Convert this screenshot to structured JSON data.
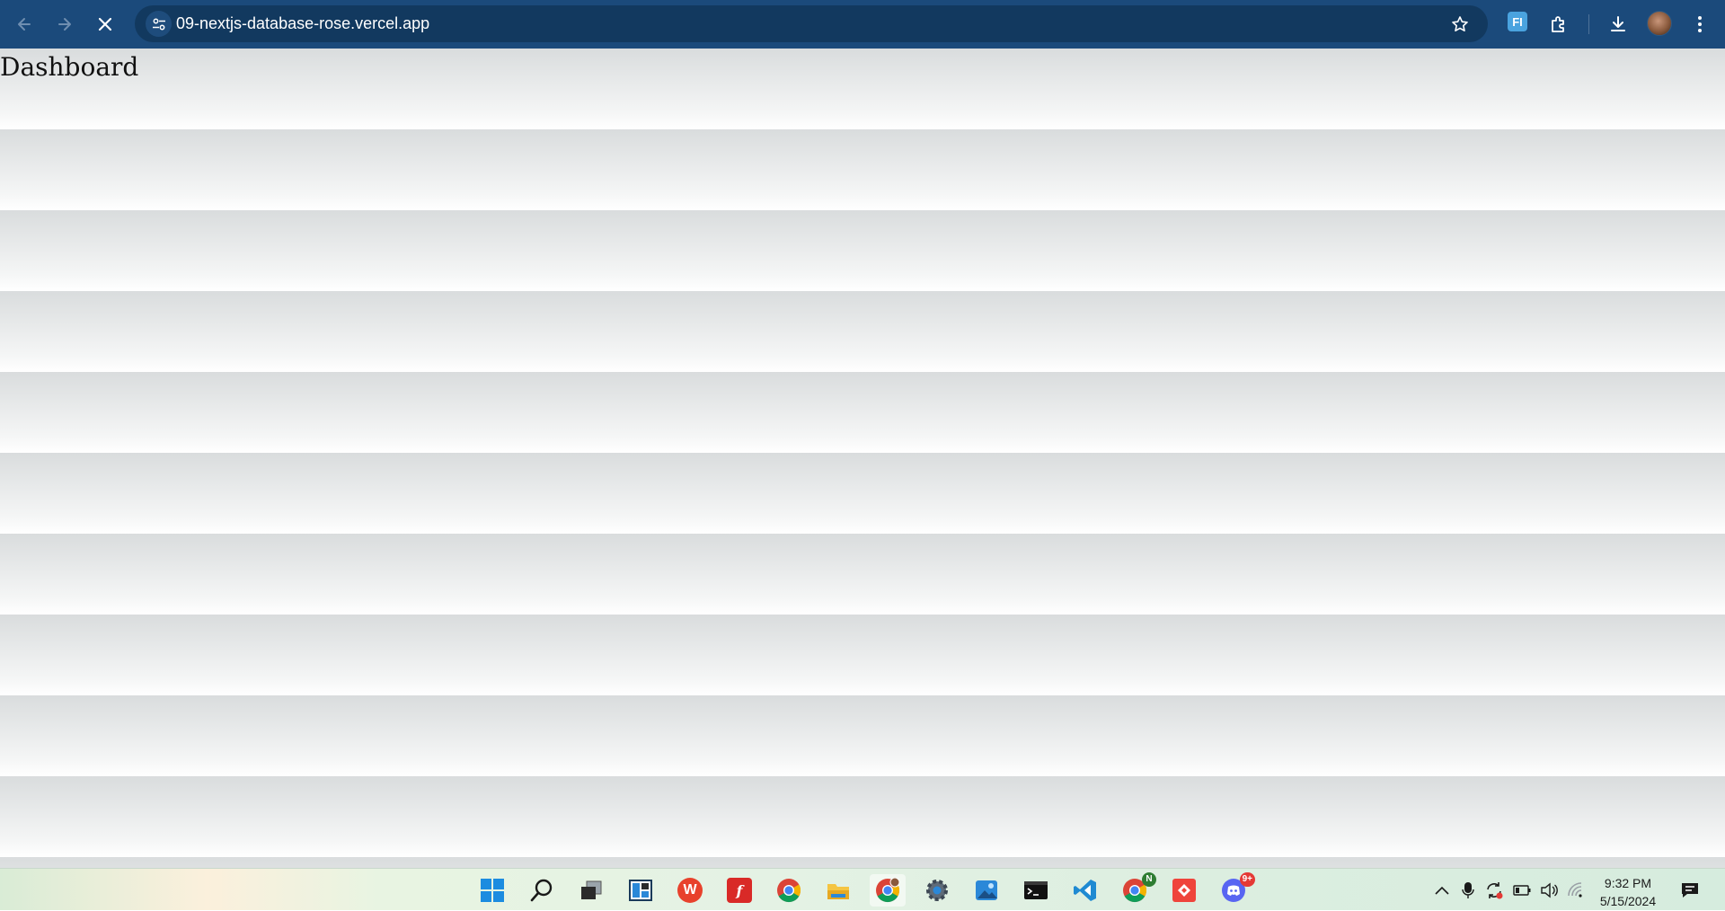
{
  "browser": {
    "url": "09-nextjs-database-rose.vercel.app",
    "extension_label": "FI",
    "icons": {
      "back": "back-arrow-icon",
      "forward": "forward-arrow-icon",
      "stop": "close-icon",
      "site_info": "tune-icon",
      "bookmark": "star-icon",
      "extensions": "puzzle-icon",
      "downloads": "download-icon",
      "menu": "more-vert-icon"
    },
    "colors": {
      "toolbar": "#1b4a7b",
      "omnibox": "#12395f"
    }
  },
  "page": {
    "title": "Dashboard"
  },
  "taskbar": {
    "apps": [
      {
        "name": "start",
        "icon": "windows-logo-icon"
      },
      {
        "name": "search",
        "icon": "search-icon"
      },
      {
        "name": "task-view",
        "icon": "task-view-icon"
      },
      {
        "name": "widgets",
        "icon": "widgets-icon"
      },
      {
        "name": "wps-office",
        "icon": "wps-icon",
        "color": "#e8412c"
      },
      {
        "name": "foxit-reader",
        "icon": "foxit-icon",
        "color": "#d92a27"
      },
      {
        "name": "chrome",
        "icon": "chrome-icon"
      },
      {
        "name": "file-explorer",
        "icon": "folder-icon",
        "color": "#f5c542"
      },
      {
        "name": "chrome-profile",
        "icon": "chrome-icon",
        "active": true
      },
      {
        "name": "settings",
        "icon": "gear-icon"
      },
      {
        "name": "photos",
        "icon": "photos-icon"
      },
      {
        "name": "terminal",
        "icon": "terminal-icon"
      },
      {
        "name": "vscode",
        "icon": "vscode-icon",
        "color": "#1f8ad2"
      },
      {
        "name": "chrome-n",
        "icon": "chrome-icon",
        "badge": "N"
      },
      {
        "name": "anydesk",
        "icon": "anydesk-icon",
        "color": "#ef443b"
      },
      {
        "name": "discord",
        "icon": "discord-icon",
        "color": "#5865f2",
        "badge": "9+"
      }
    ],
    "tray": {
      "icons": [
        "chevron-up-icon",
        "microphone-icon",
        "sync-icon",
        "battery-icon",
        "volume-icon",
        "wifi-icon",
        "notification-icon"
      ]
    },
    "time": "9:32 PM",
    "date": "5/15/2024"
  }
}
